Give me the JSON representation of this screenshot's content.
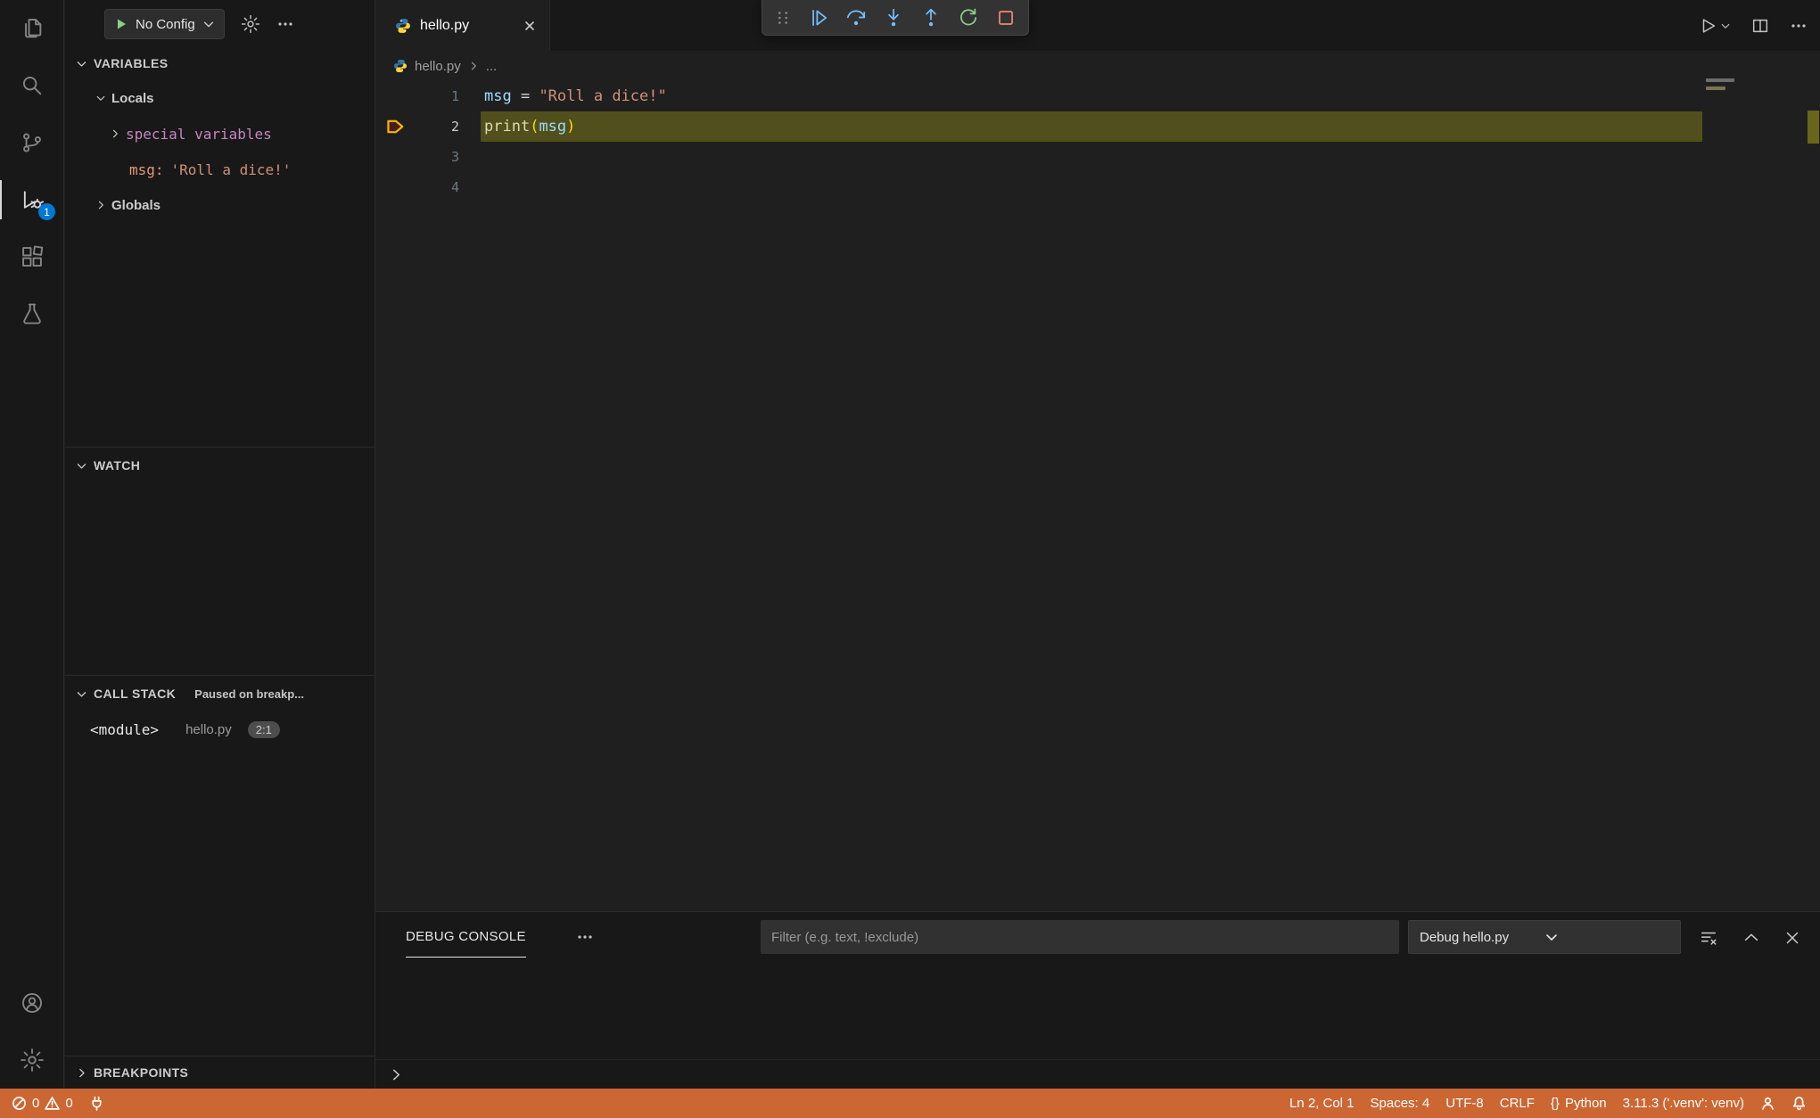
{
  "colors": {
    "status_bar_bg": "#cc6633",
    "activity_badge": "#0078d4",
    "current_line_highlight": "#514f1c",
    "debug_icon_blue": "#75beff",
    "debug_icon_green": "#89d185",
    "debug_icon_red": "#f48771",
    "breakpoint_arrow": "#f5b800"
  },
  "activity_bar": {
    "badge": "1",
    "items": [
      {
        "label": "Explorer"
      },
      {
        "label": "Search"
      },
      {
        "label": "Source Control"
      },
      {
        "label": "Run and Debug"
      },
      {
        "label": "Extensions"
      },
      {
        "label": "Testing"
      }
    ],
    "bottom_items": [
      {
        "label": "Accounts"
      },
      {
        "label": "Manage"
      }
    ]
  },
  "sidebar": {
    "config_dropdown": {
      "label": "No Config"
    },
    "variables": {
      "header": "VARIABLES",
      "locals": "Locals",
      "special": "special variables",
      "msg_name": "msg:",
      "msg_value": "'Roll a dice!'",
      "globals": "Globals"
    },
    "watch": {
      "header": "WATCH"
    },
    "call_stack": {
      "header": "CALL STACK",
      "status": "Paused on breakp...",
      "frame_name": "<module>",
      "frame_file": "hello.py",
      "frame_pos": "2:1"
    },
    "breakpoints": {
      "header": "BREAKPOINTS"
    }
  },
  "editor": {
    "tab": {
      "title": "hello.py"
    },
    "breadcrumb": {
      "file": "hello.py",
      "more": "..."
    },
    "lines": [
      {
        "num": "1"
      },
      {
        "num": "2"
      },
      {
        "num": "3"
      },
      {
        "num": "4"
      }
    ],
    "code": {
      "l1_var": "msg",
      "l1_op": " = ",
      "l1_str": "\"Roll a dice!\"",
      "l2_fn": "print",
      "l2_open": "(",
      "l2_arg": "msg",
      "l2_close": ")"
    }
  },
  "panel": {
    "tab": "DEBUG CONSOLE",
    "filter_placeholder": "Filter (e.g. text, !exclude)",
    "session": "Debug hello.py"
  },
  "status_bar": {
    "errors": "0",
    "warnings": "0",
    "cursor": "Ln 2, Col 1",
    "indent": "Spaces: 4",
    "encoding": "UTF-8",
    "eol": "CRLF",
    "braces": "{}",
    "language": "Python",
    "interpreter": "3.11.3 ('.venv': venv)"
  }
}
